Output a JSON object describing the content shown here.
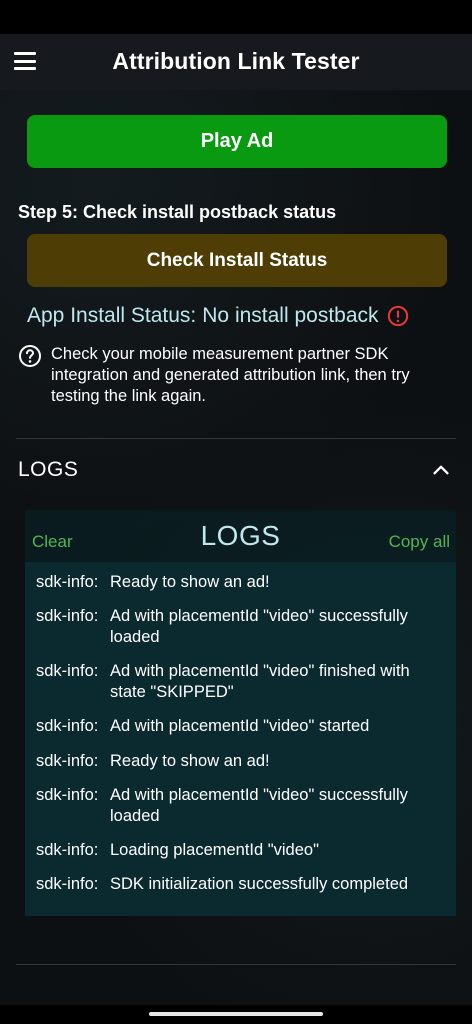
{
  "header": {
    "title": "Attribution Link Tester"
  },
  "actions": {
    "play_ad_label": "Play Ad",
    "step_label": "Step 5: Check install postback status",
    "check_status_label": "Check Install Status"
  },
  "install_status": {
    "label": "App Install Status:",
    "value": "No install postback",
    "status_color": "#e53935"
  },
  "help": {
    "text": "Check your mobile measurement partner SDK integration and generated attribution link, then try testing the link again."
  },
  "logs_section": {
    "header": "LOGS",
    "panel_title": "LOGS",
    "clear_label": "Clear",
    "copy_label": "Copy all",
    "entries": [
      {
        "source": "sdk-info:",
        "message": "Ready to show an ad!"
      },
      {
        "source": "sdk-info:",
        "message": "Ad with placementId \"video\" successfully loaded"
      },
      {
        "source": "sdk-info:",
        "message": "Ad with placementId \"video\" finished with state \"SKIPPED\""
      },
      {
        "source": "sdk-info:",
        "message": "Ad with placementId \"video\" started"
      },
      {
        "source": "sdk-info:",
        "message": "Ready to show an ad!"
      },
      {
        "source": "sdk-info:",
        "message": "Ad with placementId \"video\" successfully loaded"
      },
      {
        "source": "sdk-info:",
        "message": "Loading placementId \"video\""
      },
      {
        "source": "sdk-info:",
        "message": "SDK initialization successfully completed"
      }
    ]
  },
  "icons": {
    "menu": "menu-icon",
    "error": "error-circle-icon",
    "help": "help-circle-icon",
    "collapse": "chevron-up-icon"
  },
  "colors": {
    "play_button": "#0a9a12",
    "check_button": "#4f3d06",
    "accent_green": "#53b455",
    "status_text": "#bfe7ee"
  }
}
